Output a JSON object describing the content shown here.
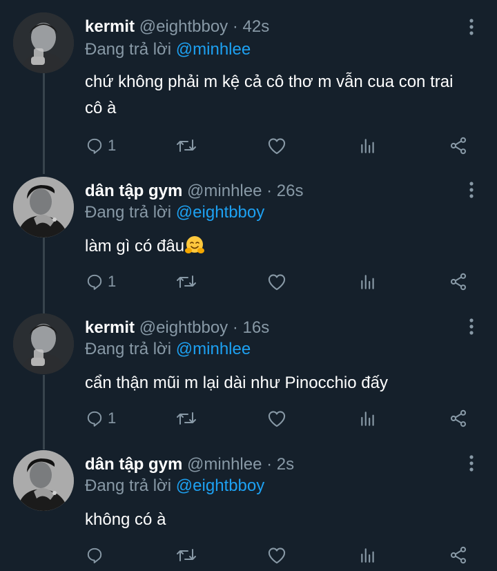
{
  "tweets": [
    {
      "name": "kermit",
      "handle": "@eightbboy",
      "separator": "·",
      "time": "42s",
      "reply_prefix": "Đang trả lời",
      "reply_to": "@minhlee",
      "text": "chứ không phải m kệ cả cô thơ m vẫn cua con trai cô à",
      "reply_count": "1",
      "avatar": "avatar-kermit"
    },
    {
      "name": "dân tập gym",
      "handle": "@minhlee",
      "separator": "·",
      "time": "26s",
      "reply_prefix": "Đang trả lời",
      "reply_to": "@eightbboy",
      "text": "làm gì có đâu",
      "emoji": "hugging-face-emoji",
      "reply_count": "1",
      "avatar": "avatar-minhlee"
    },
    {
      "name": "kermit",
      "handle": "@eightbboy",
      "separator": "·",
      "time": "16s",
      "reply_prefix": "Đang trả lời",
      "reply_to": "@minhlee",
      "text": "cẩn thận mũi m lại dài như Pinocchio đấy",
      "reply_count": "1",
      "avatar": "avatar-kermit"
    },
    {
      "name": "dân tập gym",
      "handle": "@minhlee",
      "separator": "·",
      "time": "2s",
      "reply_prefix": "Đang trả lời",
      "reply_to": "@eightbboy",
      "text": "không có à",
      "reply_count": "",
      "avatar": "avatar-minhlee"
    }
  ],
  "icons": {
    "reply": "reply-icon",
    "retweet": "retweet-icon",
    "like": "like-icon",
    "analytics": "analytics-icon",
    "share": "share-icon",
    "more": "more-options-icon"
  },
  "colors": {
    "background": "#15202b",
    "text": "#ffffff",
    "secondary": "#8899a6",
    "mention": "#1da1f2",
    "thread_line": "#38444d"
  }
}
